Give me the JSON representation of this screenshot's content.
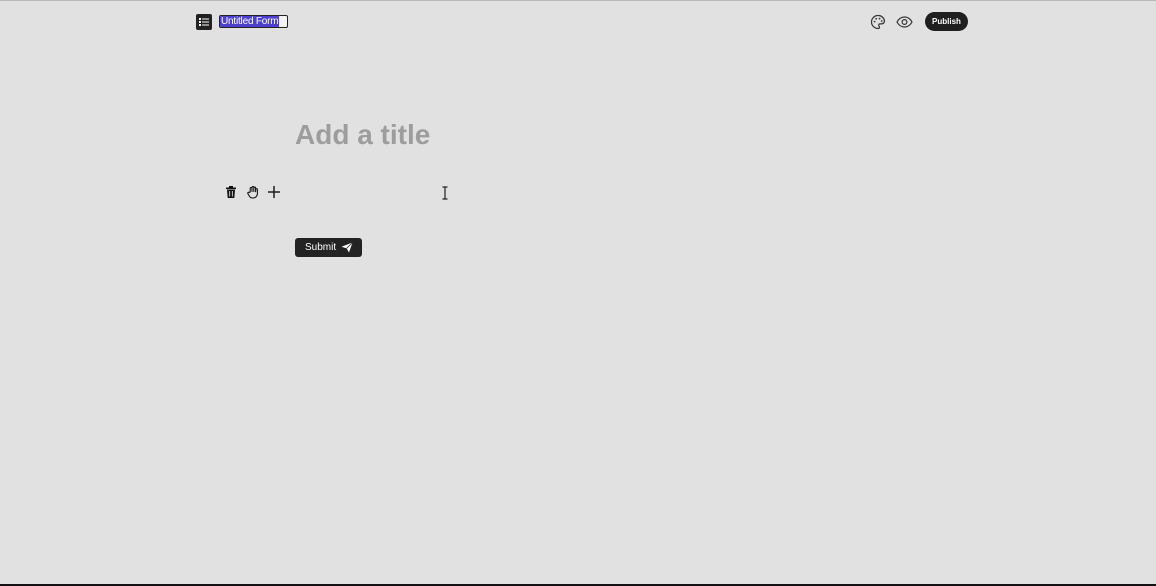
{
  "header": {
    "form_title_value": "Untitled Form",
    "publish_label": "Publish",
    "icons": {
      "menu": "list-icon",
      "theme": "palette-icon",
      "preview": "eye-icon"
    }
  },
  "form": {
    "title_placeholder": "Add a title",
    "block_tools": [
      "trash-icon",
      "drag-hand-icon",
      "plus-icon"
    ],
    "submit_label": "Submit",
    "submit_icon": "send-icon"
  },
  "colors": {
    "background": "#e1e1e1",
    "selection": "#4d3fd0",
    "button": "#1f1f1f",
    "placeholder": "#9d9d9d"
  }
}
